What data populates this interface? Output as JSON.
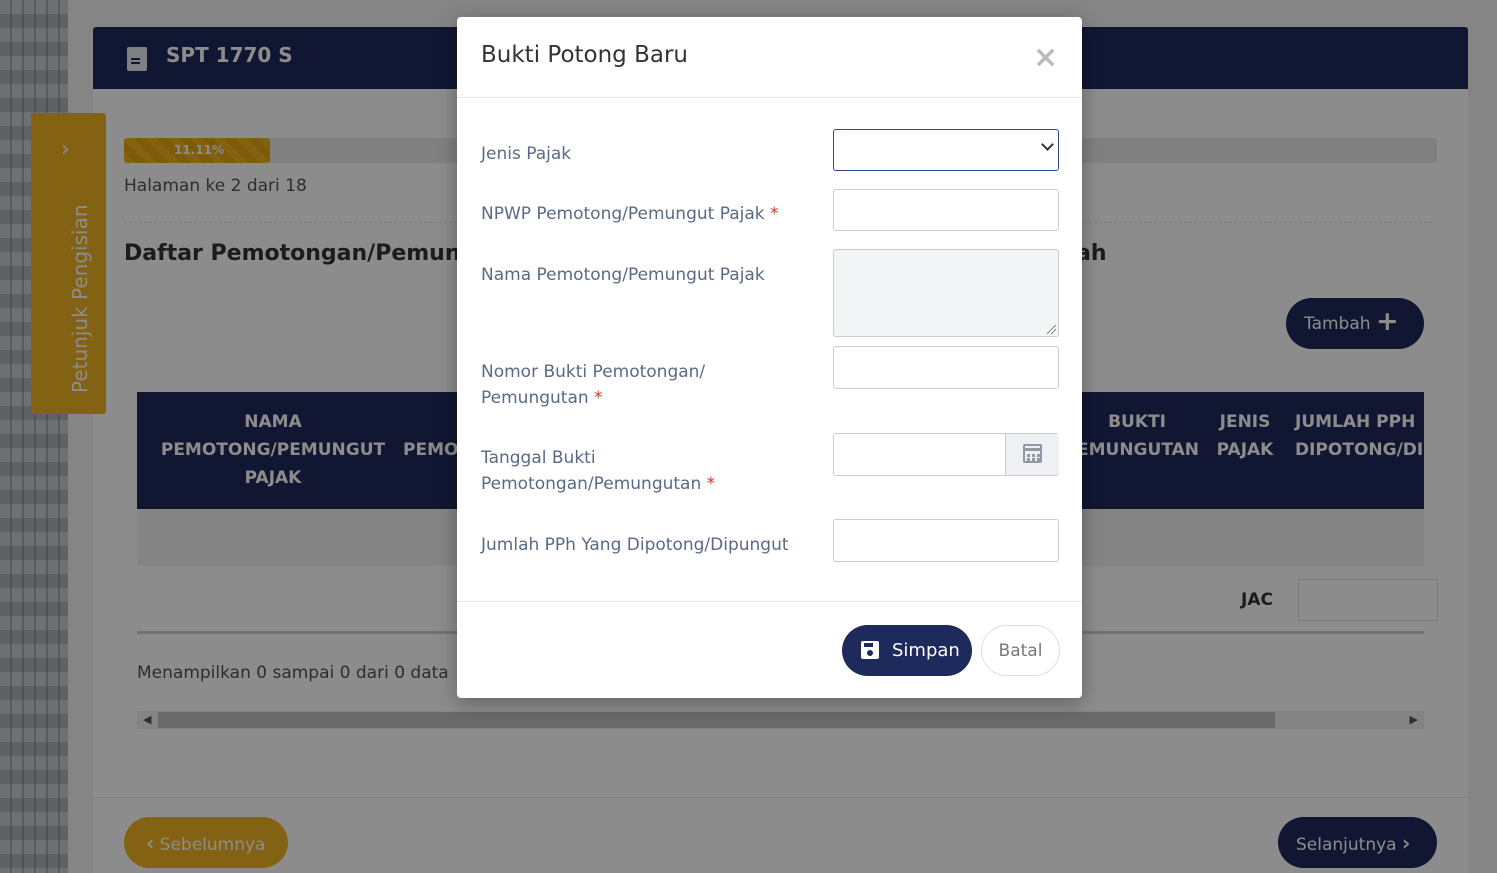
{
  "form": {
    "title": "SPT 1770 S",
    "progress": {
      "percent_label": "11.11%",
      "fraction": 0.1111
    },
    "page_info": "Halaman ke 2 dari 18",
    "section_title": "Daftar Pemotongan/Pemungutan PPh oleh Pihak Lain dan PPh yang Ditanggung Pemerintah",
    "section_title_visible_head": "Daftar Pemotongan/Pemunguta",
    "section_title_visible_tail": "ah",
    "add_button": {
      "label": "Tambah",
      "icon": "plus-icon"
    },
    "table": {
      "headers": [
        "NAMA PEMOTONG/PEMUNGUT PAJAK",
        "PEMO",
        "BUKTI EMUNGUTAN",
        "JENIS PAJAK",
        "JUMLAH PPH DIPOTONG/DI"
      ],
      "footer_label": "JAC",
      "info": "Menampilkan 0 sampai 0 dari 0 data"
    },
    "prev_button": {
      "label": "Sebelumnya"
    },
    "next_button": {
      "label": "Selanjutnya"
    },
    "side_guide": {
      "label": "Petunjuk Pengisian"
    }
  },
  "modal": {
    "title": "Bukti Potong Baru",
    "close_icon": "close-icon",
    "fields": [
      {
        "label": "Jenis Pajak",
        "required": false,
        "type": "select",
        "value": ""
      },
      {
        "label": "NPWP Pemotong/Pemungut Pajak",
        "required": true,
        "type": "text",
        "value": ""
      },
      {
        "label": "Nama Pemotong/Pemungut Pajak",
        "required": false,
        "type": "textarea",
        "value": ""
      },
      {
        "label_line1": "Nomor Bukti Pemotongan/",
        "label_line2": "Pemungutan",
        "required": true,
        "type": "text",
        "value": ""
      },
      {
        "label_line1": "Tanggal Bukti",
        "label_line2": "Pemotongan/Pemungutan",
        "required": true,
        "type": "date",
        "value": ""
      },
      {
        "label": "Jumlah PPh Yang Dipotong/Dipungut",
        "required": false,
        "type": "text",
        "value": ""
      }
    ],
    "required_marker": "*",
    "save_button": {
      "label": "Simpan",
      "icon": "save-icon"
    },
    "cancel_button": {
      "label": "Batal"
    }
  },
  "colors": {
    "primary": "#1f2a5c",
    "accent": "#f0b323",
    "required": "#d9302c",
    "label": "#5a6a85"
  }
}
